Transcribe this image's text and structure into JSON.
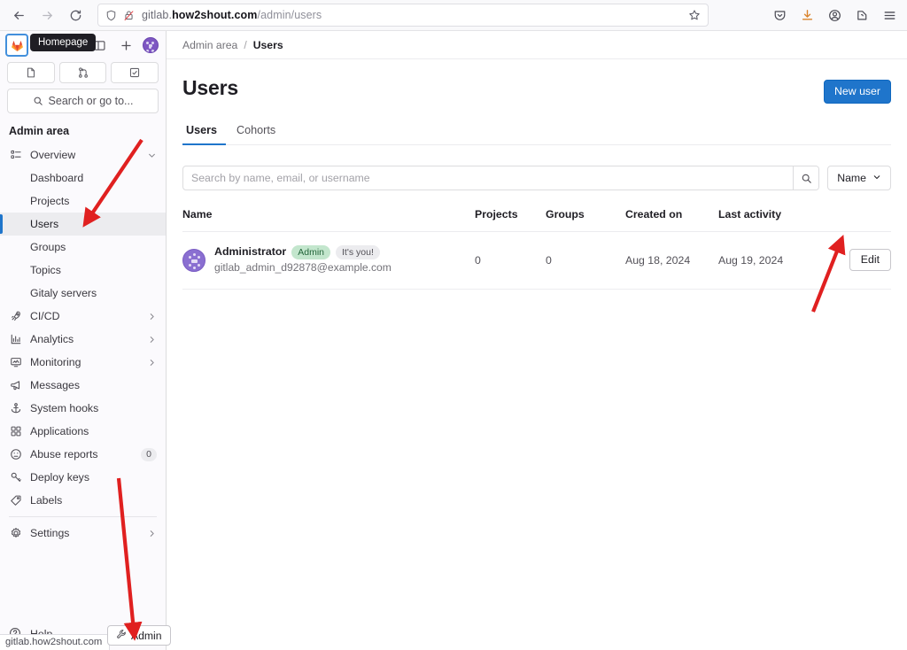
{
  "browser": {
    "back_icon": "back-arrow-icon",
    "forward_icon": "forward-arrow-icon",
    "reload_icon": "reload-icon",
    "shield_icon": "shield-icon",
    "lock_icon": "lock-crossed-icon",
    "url_scheme_host": "gitlab.",
    "url_domain": "how2shout.com",
    "url_path": "/admin/users",
    "bookmark_icon": "star-icon",
    "toolbar_icons": [
      "pocket-icon",
      "downloads-icon",
      "account-icon",
      "extensions-icon",
      "menu-icon"
    ]
  },
  "sidebar": {
    "logo_tooltip": "Homepage",
    "quick_actions": [
      "issues-icon",
      "merge-requests-icon",
      "todo-list-icon"
    ],
    "search_placeholder": "Search or go to...",
    "section_title": "Admin area",
    "items": [
      {
        "label": "Overview",
        "icon": "overview-icon",
        "type": "group",
        "chevron": "down",
        "active": false
      },
      {
        "label": "Dashboard",
        "icon": "",
        "type": "sub",
        "chevron": "",
        "active": false
      },
      {
        "label": "Projects",
        "icon": "",
        "type": "sub",
        "chevron": "",
        "active": false
      },
      {
        "label": "Users",
        "icon": "",
        "type": "sub",
        "chevron": "",
        "active": true
      },
      {
        "label": "Groups",
        "icon": "",
        "type": "sub",
        "chevron": "",
        "active": false
      },
      {
        "label": "Topics",
        "icon": "",
        "type": "sub",
        "chevron": "",
        "active": false
      },
      {
        "label": "Gitaly servers",
        "icon": "",
        "type": "sub",
        "chevron": "",
        "active": false
      },
      {
        "label": "CI/CD",
        "icon": "rocket-icon",
        "type": "group",
        "chevron": "right",
        "active": false
      },
      {
        "label": "Analytics",
        "icon": "chart-icon",
        "type": "group",
        "chevron": "right",
        "active": false
      },
      {
        "label": "Monitoring",
        "icon": "monitor-icon",
        "type": "group",
        "chevron": "right",
        "active": false
      },
      {
        "label": "Messages",
        "icon": "megaphone-icon",
        "type": "item",
        "chevron": "",
        "active": false
      },
      {
        "label": "System hooks",
        "icon": "anchor-icon",
        "type": "item",
        "chevron": "",
        "active": false
      },
      {
        "label": "Applications",
        "icon": "grid-icon",
        "type": "item",
        "chevron": "",
        "active": false
      },
      {
        "label": "Abuse reports",
        "icon": "face-icon",
        "type": "item",
        "chevron": "",
        "active": false,
        "count": "0"
      },
      {
        "label": "Deploy keys",
        "icon": "key-icon",
        "type": "item",
        "chevron": "",
        "active": false
      },
      {
        "label": "Labels",
        "icon": "label-icon",
        "type": "item",
        "chevron": "",
        "active": false
      },
      {
        "label": "Settings",
        "icon": "gear-icon",
        "type": "group",
        "chevron": "right",
        "active": false
      }
    ],
    "help_label": "Help"
  },
  "breadcrumb": {
    "root": "Admin area",
    "separator": "/",
    "current": "Users"
  },
  "page": {
    "title": "Users",
    "new_user_label": "New user",
    "tabs": [
      {
        "label": "Users",
        "active": true
      },
      {
        "label": "Cohorts",
        "active": false
      }
    ],
    "search": {
      "placeholder": "Search by name, email, or username",
      "value": "",
      "submit_icon": "search-icon"
    },
    "sort": {
      "label": "Name",
      "chevron_icon": "chevron-down-icon"
    }
  },
  "table": {
    "columns": [
      "Name",
      "Projects",
      "Groups",
      "Created on",
      "Last activity",
      ""
    ],
    "rows": [
      {
        "name": "Administrator",
        "badge_admin": "Admin",
        "badge_you": "It's you!",
        "email": "gitlab_admin_d92878@example.com",
        "projects": "0",
        "groups": "0",
        "created_on": "Aug 18, 2024",
        "last_activity": "Aug 19, 2024",
        "action_label": "Edit"
      }
    ]
  },
  "statusbar": {
    "url": "gitlab.how2shout.com"
  },
  "admin_fab": {
    "label": "Admin",
    "icon": "wrench-icon"
  },
  "colors": {
    "accent_blue": "#1f75cb",
    "badge_green_bg": "#c3e6cd",
    "badge_green_text": "#24663b",
    "annotation_red": "#e02020",
    "sidebar_bg": "#fbfafd",
    "active_item_bg": "#ececef"
  }
}
